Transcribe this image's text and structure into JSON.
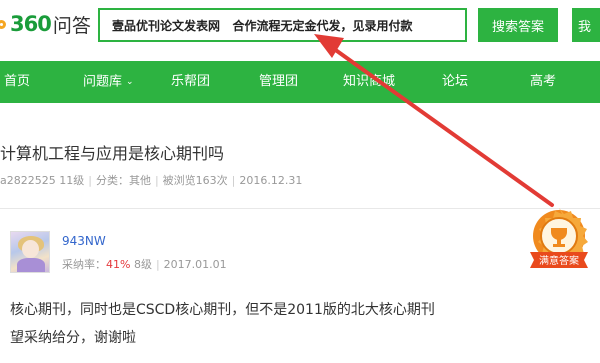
{
  "header": {
    "logo_num": "360",
    "logo_cn": "问答",
    "search_value": "壹品优刊论文发表网   合作流程无定金代发，见录用付款",
    "search_button": "搜索答案",
    "ask_button": "我"
  },
  "nav": {
    "items": [
      {
        "label": "首页"
      },
      {
        "label": "问题库"
      },
      {
        "label": "乐帮团"
      },
      {
        "label": "管理团"
      },
      {
        "label": "知识商城"
      },
      {
        "label": "论坛"
      },
      {
        "label": "高考"
      }
    ]
  },
  "question": {
    "title": "计算机工程与应用是核心期刊吗",
    "asker": "a2822525",
    "asker_level": "11级",
    "category": "分类：其他",
    "views": "被浏览163次",
    "date": "2016.12.31"
  },
  "answer": {
    "user": "943NW",
    "rate_label": "采纳率：",
    "rate_value": "41%",
    "level": "8级",
    "date": "2017.01.01",
    "line1": "核心期刊，同时也是CSCD核心期刊，但不是2011版的北大核心期刊",
    "line2": "望采纳给分，谢谢啦",
    "badge_text": "满意答案"
  },
  "colors": {
    "brand_green": "#2db341",
    "arrow_red": "#e23b35",
    "badge_orange": "#f08a1e"
  },
  "icons": [
    "logo-ring-icon",
    "chevron-down-icon",
    "satisfied-answer-badge-icon",
    "annotation-arrow-icon"
  ]
}
